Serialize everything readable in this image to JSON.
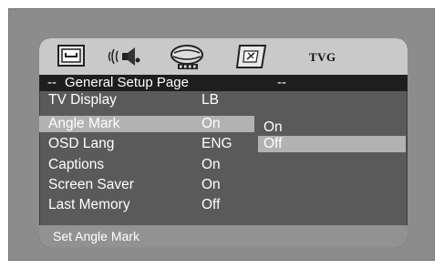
{
  "icons": [
    {
      "name": "general-setup-icon"
    },
    {
      "name": "audio-setup-icon"
    },
    {
      "name": "video-setup-icon"
    },
    {
      "name": "preference-icon"
    },
    {
      "name": "tvg-icon",
      "label": "TVG"
    }
  ],
  "title": {
    "left_dash": "--",
    "text": "General Setup Page",
    "right_dash": "--"
  },
  "menu": [
    {
      "label": "TV Display",
      "value": "LB"
    },
    {
      "label": "Angle Mark",
      "value": "On"
    },
    {
      "label": "OSD Lang",
      "value": "ENG"
    },
    {
      "label": "Captions",
      "value": "On"
    },
    {
      "label": "Screen Saver",
      "value": "On"
    },
    {
      "label": "Last Memory",
      "value": "Off"
    }
  ],
  "submenu": [
    {
      "label": "On"
    },
    {
      "label": "Off"
    }
  ],
  "status": "Set Angle Mark",
  "colors": {
    "frame": "#8c8c8c",
    "screen": "#5a5a5a",
    "icon_bar": "#c9c9c9",
    "title_bar": "#1e1e1e",
    "highlight": "#b2b2b2",
    "status_bar": "#929292"
  }
}
